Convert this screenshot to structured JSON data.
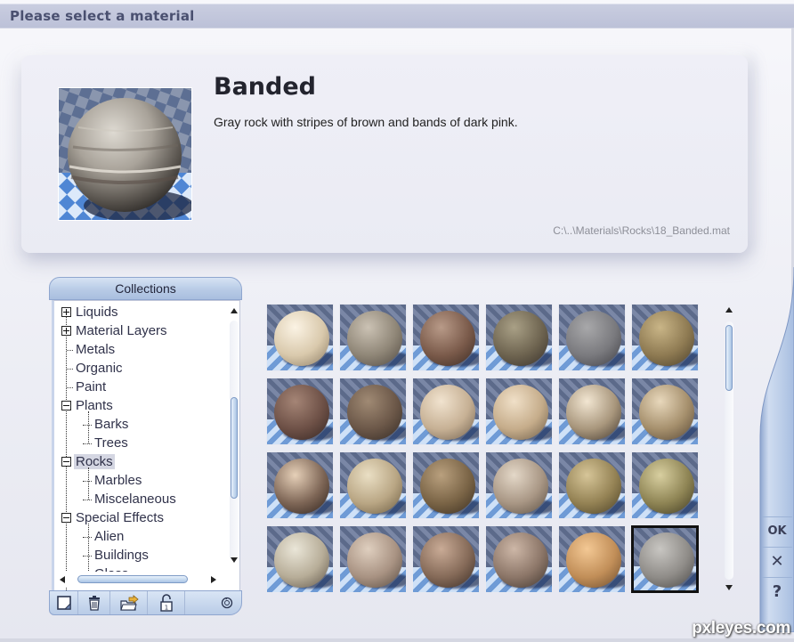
{
  "window": {
    "title": "Please select a material"
  },
  "selected_material": {
    "name": "Banded",
    "description": "Gray rock with stripes of brown and bands of dark pink.",
    "path": "C:\\..\\Materials\\Rocks\\18_Banded.mat",
    "preview_icon": "banded-rock-sphere"
  },
  "collections": {
    "header": "Collections",
    "tree": [
      {
        "label": "Liquids",
        "level": 0,
        "expander": "plus"
      },
      {
        "label": "Material Layers",
        "level": 0,
        "expander": "plus"
      },
      {
        "label": "Metals",
        "level": 0,
        "expander": "none"
      },
      {
        "label": "Organic",
        "level": 0,
        "expander": "none"
      },
      {
        "label": "Paint",
        "level": 0,
        "expander": "none"
      },
      {
        "label": "Plants",
        "level": 0,
        "expander": "minus"
      },
      {
        "label": "Barks",
        "level": 1,
        "expander": "none"
      },
      {
        "label": "Trees",
        "level": 1,
        "expander": "none"
      },
      {
        "label": "Rocks",
        "level": 0,
        "expander": "minus",
        "selected": true
      },
      {
        "label": "Marbles",
        "level": 1,
        "expander": "none"
      },
      {
        "label": "Miscelaneous",
        "level": 1,
        "expander": "none"
      },
      {
        "label": "Special Effects",
        "level": 0,
        "expander": "minus"
      },
      {
        "label": "Alien",
        "level": 1,
        "expander": "none"
      },
      {
        "label": "Buildings",
        "level": 1,
        "expander": "none"
      },
      {
        "label": "Glass",
        "level": 1,
        "expander": "none"
      }
    ],
    "toolbar": [
      {
        "name": "new-collection",
        "icon": "new-document-icon"
      },
      {
        "name": "delete",
        "icon": "trash-icon"
      },
      {
        "name": "import",
        "icon": "folder-arrow-icon"
      },
      {
        "name": "unlock",
        "icon": "padlock-open-icon"
      },
      {
        "name": "refresh",
        "icon": "refresh-icon"
      }
    ],
    "tree_scroll_position": 0.55
  },
  "material_grid": {
    "columns": 6,
    "selected_index": 23,
    "items": [
      {
        "colors": [
          "#fbf3e4",
          "#d9c9ac",
          "#8a7a62"
        ]
      },
      {
        "colors": [
          "#cbc2b4",
          "#8f8677",
          "#4f4840"
        ]
      },
      {
        "colors": [
          "#b89a88",
          "#7a5a4a",
          "#3a2a22"
        ]
      },
      {
        "colors": [
          "#a9a086",
          "#6e6450",
          "#37302a"
        ]
      },
      {
        "colors": [
          "#a8a8aa",
          "#7a7a7e",
          "#3f3f44"
        ]
      },
      {
        "colors": [
          "#c9b587",
          "#8e7a52",
          "#4a3f2a"
        ]
      },
      {
        "colors": [
          "#a58576",
          "#6d5046",
          "#342522"
        ]
      },
      {
        "colors": [
          "#a08a74",
          "#6b5748",
          "#332a24"
        ]
      },
      {
        "colors": [
          "#f1e3cf",
          "#c6b094",
          "#6e5e4c"
        ]
      },
      {
        "colors": [
          "#f0e0c8",
          "#c5ac8a",
          "#6a5a46"
        ]
      },
      {
        "colors": [
          "#f2e6d2",
          "#a8967c",
          "#3f352c"
        ]
      },
      {
        "colors": [
          "#e8d8bc",
          "#a58f6c",
          "#564634"
        ]
      },
      {
        "colors": [
          "#e6d0b8",
          "#7e6656",
          "#2c201a"
        ]
      },
      {
        "colors": [
          "#eadfc4",
          "#b9a684",
          "#6a5a40"
        ]
      },
      {
        "colors": [
          "#b9a07e",
          "#7a6446",
          "#3a2e20"
        ]
      },
      {
        "colors": [
          "#e4d8c8",
          "#a89684",
          "#5a4e42"
        ]
      },
      {
        "colors": [
          "#d6c598",
          "#948254",
          "#4a4026"
        ]
      },
      {
        "colors": [
          "#d8cfa0",
          "#8e8454",
          "#3f3a22"
        ]
      },
      {
        "colors": [
          "#eae6d8",
          "#b7ad98",
          "#5e5448"
        ]
      },
      {
        "colors": [
          "#dfcfbf",
          "#a89282",
          "#564a40"
        ]
      },
      {
        "colors": [
          "#c9ab96",
          "#856a58",
          "#3a2c24"
        ]
      },
      {
        "colors": [
          "#cdb7a7",
          "#8c7668",
          "#40362f"
        ]
      },
      {
        "colors": [
          "#f3c894",
          "#c18e58",
          "#6a4a2c"
        ]
      },
      {
        "colors": [
          "#c8c6c2",
          "#8f8c88",
          "#4a4846"
        ]
      }
    ],
    "scroll_position": 0.0
  },
  "actions": {
    "ok_label": "OK",
    "cancel_label": "✕",
    "help_label": "?"
  },
  "watermark": "pxleyes.com"
}
